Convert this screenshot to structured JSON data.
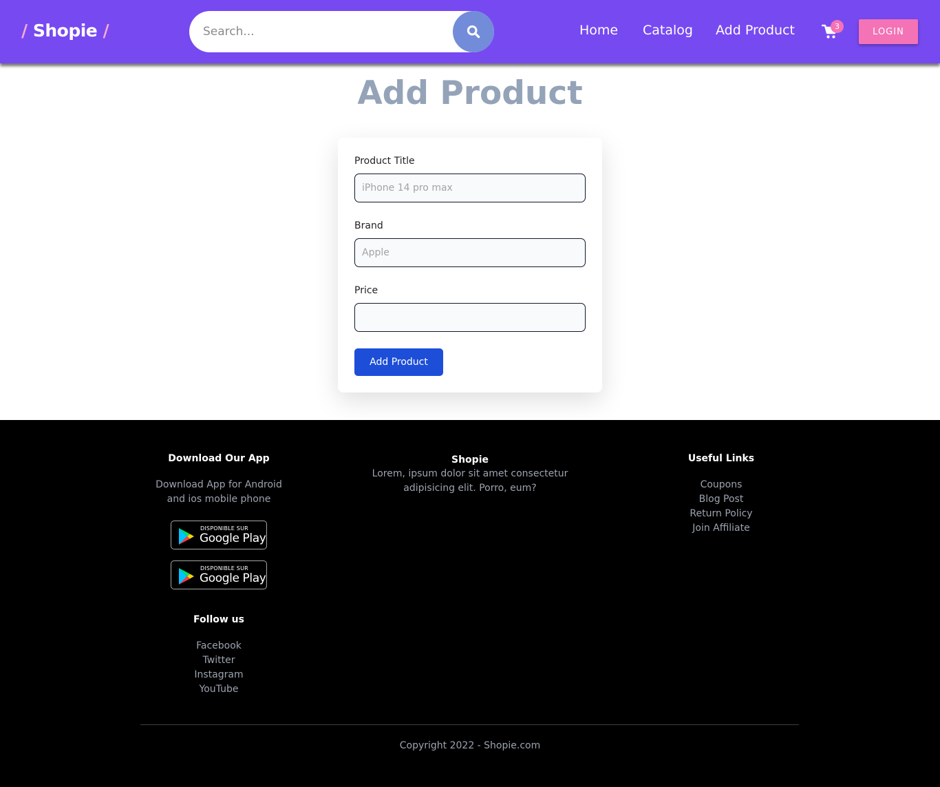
{
  "navbar": {
    "logo_slash_left": "/",
    "logo_text": "Shopie",
    "logo_slash_right": "/",
    "search_placeholder": "Search...",
    "search_icon": "search-icon",
    "links": [
      "Home",
      "Catalog",
      "Add Product"
    ],
    "cart_icon": "cart-icon",
    "cart_count": "3",
    "login_label": "LOGIN",
    "colors": {
      "background": "#7749f1",
      "accent_pink": "#f472b6",
      "search_button": "#738cd9"
    }
  },
  "main": {
    "title": "Add Product",
    "form": {
      "title_label": "Product Title",
      "title_placeholder": "iPhone 14 pro max",
      "brand_label": "Brand",
      "brand_placeholder": "Apple",
      "price_label": "Price",
      "price_placeholder": "",
      "submit_label": "Add Product",
      "submit_color": "#1d4ed8"
    }
  },
  "footer": {
    "download": {
      "heading": "Download Our App",
      "text": "Download App for Android and ios mobile phone",
      "badges": [
        {
          "top": "DISPONIBLE SUR",
          "name": "Google Play"
        },
        {
          "top": "DISPONIBLE SUR",
          "name": "Google Play"
        }
      ]
    },
    "follow": {
      "heading": "Follow us",
      "links": [
        "Facebook",
        "Twitter",
        "Instagram",
        "YouTube"
      ]
    },
    "about": {
      "heading": "Shopie",
      "text": "Lorem, ipsum dolor sit amet consectetur adipisicing elit. Porro, eum?"
    },
    "useful": {
      "heading": "Useful Links",
      "links": [
        "Coupons",
        "Blog Post",
        "Return Policy",
        "Join Affiliate"
      ]
    },
    "copyright": "Copyright 2022 - Shopie.com"
  }
}
